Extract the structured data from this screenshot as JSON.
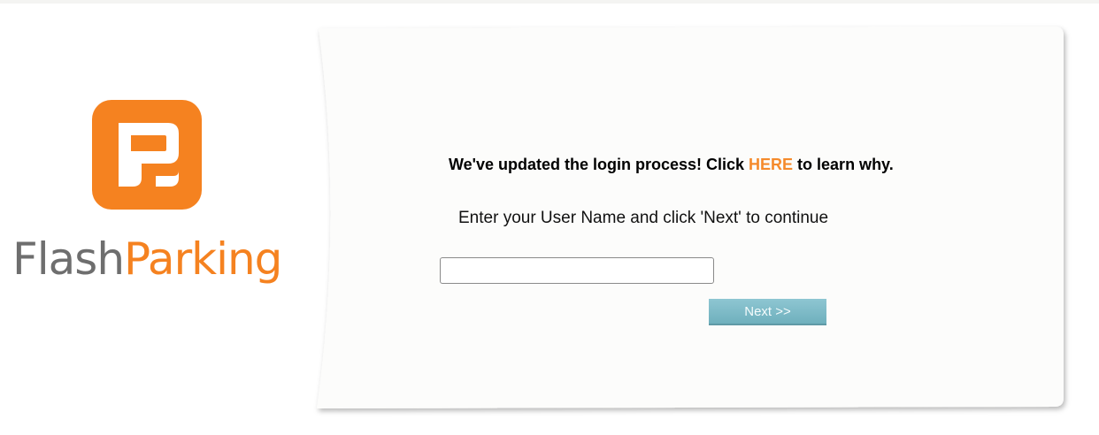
{
  "brand": {
    "name_part1": "Flash",
    "name_part2": "Parking",
    "logo_icon": "flashparking-logo-icon",
    "colors": {
      "orange": "#f58220",
      "gray": "#6e6e6e"
    }
  },
  "login": {
    "notice_before": "We've updated the login process! Click ",
    "notice_link": "HERE",
    "notice_after": " to learn why.",
    "instruction": "Enter your User Name and click 'Next' to continue",
    "username_value": "",
    "username_placeholder": "",
    "next_label": "Next >>"
  },
  "colors": {
    "link": "#f58a2b",
    "button": "#7fbcc8",
    "card_background": "#fcfcfb"
  }
}
